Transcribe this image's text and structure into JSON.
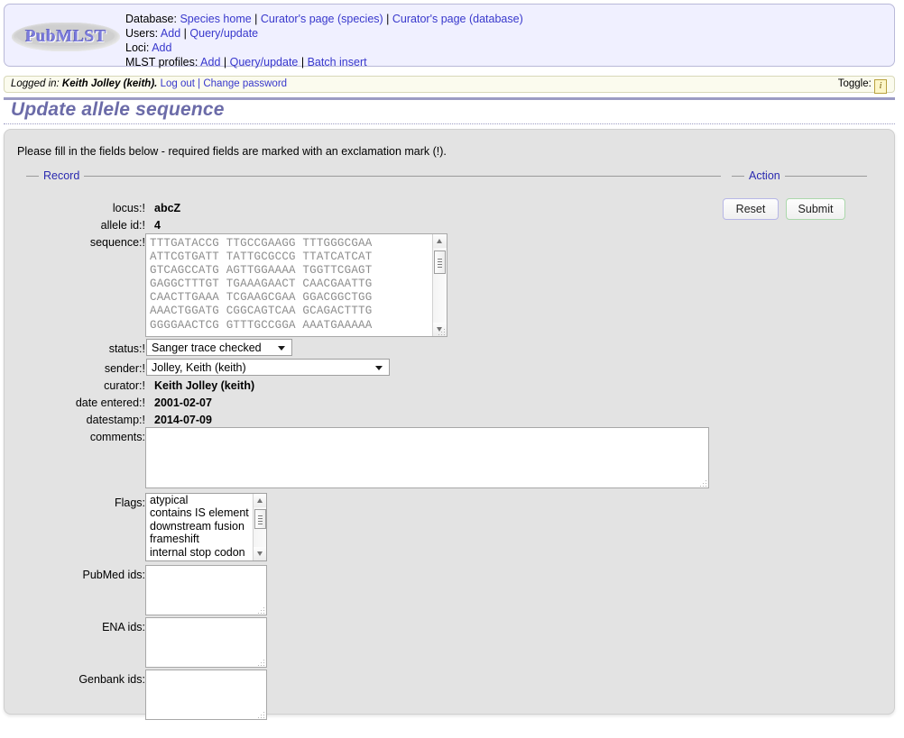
{
  "header": {
    "logo_text": "PubMLST",
    "nav_rows": [
      {
        "label": "Database:",
        "links": [
          "Species home",
          "Curator's page (species)",
          "Curator's page (database)"
        ]
      },
      {
        "label": "Users:",
        "links": [
          "Add",
          "Query/update"
        ]
      },
      {
        "label": "Loci:",
        "links": [
          "Add"
        ]
      },
      {
        "label": "MLST profiles:",
        "links": [
          "Add",
          "Query/update",
          "Batch insert"
        ]
      }
    ],
    "separator": "|"
  },
  "login_bar": {
    "prefix": "Logged in:",
    "user": "Keith Jolley (keith).",
    "logout_label": "Log out",
    "separator": "|",
    "change_password_label": "Change password",
    "toggle_label": "Toggle:",
    "toggle_icon": "i"
  },
  "page": {
    "title": "Update allele sequence",
    "instructions": "Please fill in the fields below - required fields are marked with an exclamation mark (!)."
  },
  "record": {
    "legend": "Record",
    "locus_label": "locus:!",
    "locus_value": "abcZ",
    "allele_id_label": "allele id:!",
    "allele_id_value": "4",
    "sequence_label": "sequence:!",
    "sequence_value": "TTTGATACCG TTGCCGAAGG TTTGGGCGAA\nATTCGTGATT TATTGCGCCG TTATCATCAT\nGTCAGCCATG AGTTGGAAAA TGGTTCGAGT\nGAGGCTTTGT TGAAAGAACT CAACGAATTG\nCAACTTGAAA TCGAAGCGAA GGACGGCTGG\nAAACTGGATG CGGCAGTCAA GCAGACTTTG\nGGGGAACTCG GTTTGCCGGA AAATGAAAAA",
    "status_label": "status:!",
    "status_value": "Sanger trace checked",
    "sender_label": "sender:!",
    "sender_value": "Jolley, Keith (keith)",
    "curator_label": "curator:!",
    "curator_value": "Keith Jolley (keith)",
    "date_entered_label": "date entered:!",
    "date_entered_value": "2001-02-07",
    "datestamp_label": "datestamp:!",
    "datestamp_value": "2014-07-09",
    "comments_label": "comments:",
    "comments_value": "",
    "flags_label": "Flags:",
    "flags_options": [
      "atypical",
      "contains IS element",
      "downstream fusion",
      "frameshift",
      "internal stop codon"
    ],
    "pubmed_label": "PubMed ids:",
    "pubmed_value": "",
    "ena_label": "ENA ids:",
    "ena_value": "",
    "genbank_label": "Genbank ids:",
    "genbank_value": ""
  },
  "action": {
    "legend": "Action",
    "reset_label": "Reset",
    "submit_label": "Submit"
  },
  "colors": {
    "link": "#3838cc",
    "title": "#6b6ba8",
    "legend": "#2a2ab0",
    "panel_bg": "#e3e3e3",
    "header_bg": "#f0f0ff",
    "login_bg": "#fbfbee",
    "reset_border": "#b7b7e6",
    "submit_border": "#abd8ab"
  }
}
